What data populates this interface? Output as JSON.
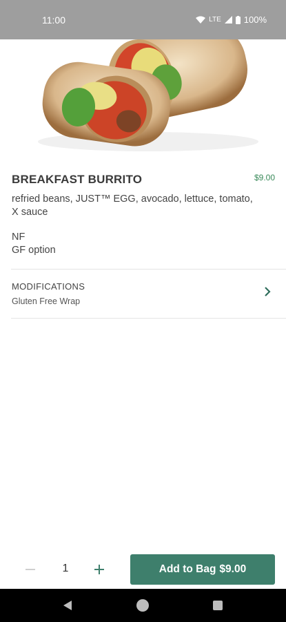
{
  "status_bar": {
    "time": "11:00",
    "network": "LTE",
    "battery": "100%"
  },
  "item": {
    "image_name": "breakfast-burrito-image",
    "title": "BREAKFAST BURRITO",
    "price": "$9.00",
    "description": "refried beans, JUST™ EGG, avocado, lettuce, tomato, X sauce",
    "tags": [
      "NF",
      "GF option"
    ]
  },
  "modifications": {
    "title": "MODIFICATIONS",
    "value": "Gluten Free Wrap"
  },
  "order": {
    "quantity": "1",
    "add_label": "Add to Bag",
    "add_price": "$9.00"
  },
  "colors": {
    "accent": "#3e7f6c",
    "price": "#3a8a5a",
    "status_bar": "#9e9e9e"
  }
}
